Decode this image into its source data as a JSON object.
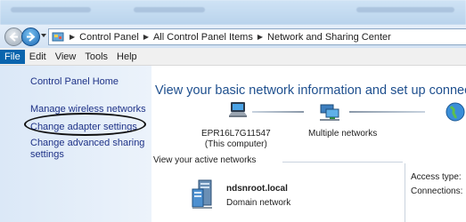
{
  "window": {
    "breadcrumbs": [
      "Control Panel",
      "All Control Panel Items",
      "Network and Sharing Center"
    ]
  },
  "menu": [
    "File",
    "Edit",
    "View",
    "Tools",
    "Help"
  ],
  "sidebar": {
    "home": "Control Panel Home",
    "links": [
      "Manage wireless networks",
      "Change adapter settings",
      "Change advanced sharing",
      "settings"
    ]
  },
  "main": {
    "heading": "View your basic network information and set up connec",
    "computer_name": "EPR16L7G11547",
    "computer_sub": "(This computer)",
    "network_label": "Multiple networks",
    "active_networks_label": "View your active networks",
    "network_name": "ndsnroot.local",
    "network_type": "Domain network",
    "access_type_label": "Access type:",
    "connections_label": "Connections:"
  },
  "icons": [
    "back-icon",
    "forward-icon",
    "control-panel-icon",
    "computer-icon",
    "network-icon",
    "globe-icon",
    "server-icon"
  ],
  "colors": {
    "link": "#1e3287",
    "heading": "#1e4f8e",
    "menu_active": "#0a64ad"
  }
}
